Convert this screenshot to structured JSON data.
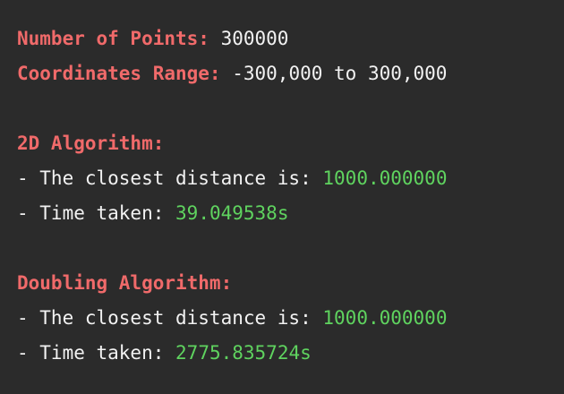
{
  "points_line": {
    "label": "Number of Points:",
    "value": "300000"
  },
  "range_line": {
    "label": "Coordinates Range:",
    "value": "-300,000 to 300,000"
  },
  "algo_2d": {
    "heading": "2D Algorithm:",
    "distance_prefix": "- The closest distance is:",
    "distance_value": "1000.000000",
    "time_prefix": "- Time taken:",
    "time_value": "39.049538s"
  },
  "algo_doubling": {
    "heading": "Doubling Algorithm:",
    "distance_prefix": "- The closest distance is:",
    "distance_value": "1000.000000",
    "time_prefix": "- Time taken:",
    "time_value": "2775.835724s"
  },
  "colors": {
    "background": "#2b2b2b",
    "label": "#f06a6a",
    "text": "#f2f2f2",
    "value": "#5fd35f"
  }
}
